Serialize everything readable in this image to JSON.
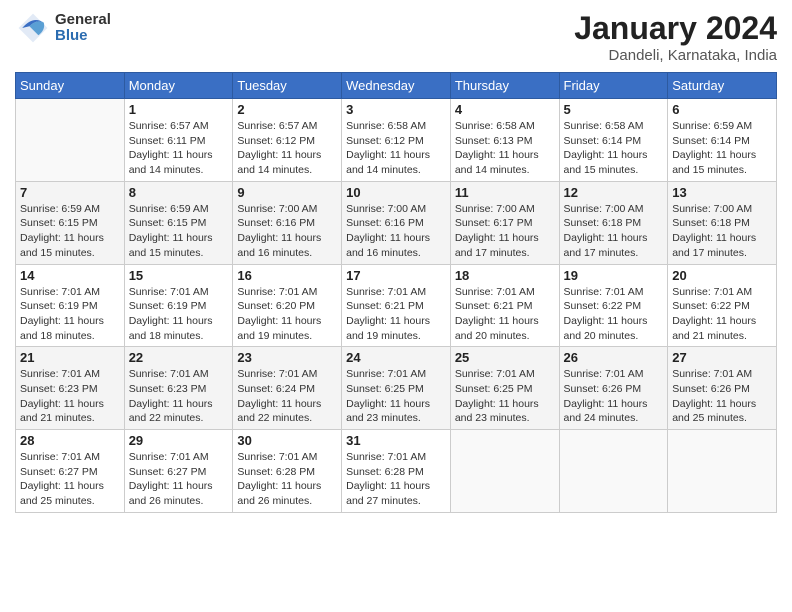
{
  "header": {
    "logo_general": "General",
    "logo_blue": "Blue",
    "title": "January 2024",
    "subtitle": "Dandeli, Karnataka, India"
  },
  "days_of_week": [
    "Sunday",
    "Monday",
    "Tuesday",
    "Wednesday",
    "Thursday",
    "Friday",
    "Saturday"
  ],
  "weeks": [
    [
      {
        "day": "",
        "empty": true
      },
      {
        "day": "1",
        "sunrise": "Sunrise: 6:57 AM",
        "sunset": "Sunset: 6:11 PM",
        "daylight": "Daylight: 11 hours and 14 minutes."
      },
      {
        "day": "2",
        "sunrise": "Sunrise: 6:57 AM",
        "sunset": "Sunset: 6:12 PM",
        "daylight": "Daylight: 11 hours and 14 minutes."
      },
      {
        "day": "3",
        "sunrise": "Sunrise: 6:58 AM",
        "sunset": "Sunset: 6:12 PM",
        "daylight": "Daylight: 11 hours and 14 minutes."
      },
      {
        "day": "4",
        "sunrise": "Sunrise: 6:58 AM",
        "sunset": "Sunset: 6:13 PM",
        "daylight": "Daylight: 11 hours and 14 minutes."
      },
      {
        "day": "5",
        "sunrise": "Sunrise: 6:58 AM",
        "sunset": "Sunset: 6:14 PM",
        "daylight": "Daylight: 11 hours and 15 minutes."
      },
      {
        "day": "6",
        "sunrise": "Sunrise: 6:59 AM",
        "sunset": "Sunset: 6:14 PM",
        "daylight": "Daylight: 11 hours and 15 minutes."
      }
    ],
    [
      {
        "day": "7",
        "sunrise": "Sunrise: 6:59 AM",
        "sunset": "Sunset: 6:15 PM",
        "daylight": "Daylight: 11 hours and 15 minutes."
      },
      {
        "day": "8",
        "sunrise": "Sunrise: 6:59 AM",
        "sunset": "Sunset: 6:15 PM",
        "daylight": "Daylight: 11 hours and 15 minutes."
      },
      {
        "day": "9",
        "sunrise": "Sunrise: 7:00 AM",
        "sunset": "Sunset: 6:16 PM",
        "daylight": "Daylight: 11 hours and 16 minutes."
      },
      {
        "day": "10",
        "sunrise": "Sunrise: 7:00 AM",
        "sunset": "Sunset: 6:16 PM",
        "daylight": "Daylight: 11 hours and 16 minutes."
      },
      {
        "day": "11",
        "sunrise": "Sunrise: 7:00 AM",
        "sunset": "Sunset: 6:17 PM",
        "daylight": "Daylight: 11 hours and 17 minutes."
      },
      {
        "day": "12",
        "sunrise": "Sunrise: 7:00 AM",
        "sunset": "Sunset: 6:18 PM",
        "daylight": "Daylight: 11 hours and 17 minutes."
      },
      {
        "day": "13",
        "sunrise": "Sunrise: 7:00 AM",
        "sunset": "Sunset: 6:18 PM",
        "daylight": "Daylight: 11 hours and 17 minutes."
      }
    ],
    [
      {
        "day": "14",
        "sunrise": "Sunrise: 7:01 AM",
        "sunset": "Sunset: 6:19 PM",
        "daylight": "Daylight: 11 hours and 18 minutes."
      },
      {
        "day": "15",
        "sunrise": "Sunrise: 7:01 AM",
        "sunset": "Sunset: 6:19 PM",
        "daylight": "Daylight: 11 hours and 18 minutes."
      },
      {
        "day": "16",
        "sunrise": "Sunrise: 7:01 AM",
        "sunset": "Sunset: 6:20 PM",
        "daylight": "Daylight: 11 hours and 19 minutes."
      },
      {
        "day": "17",
        "sunrise": "Sunrise: 7:01 AM",
        "sunset": "Sunset: 6:21 PM",
        "daylight": "Daylight: 11 hours and 19 minutes."
      },
      {
        "day": "18",
        "sunrise": "Sunrise: 7:01 AM",
        "sunset": "Sunset: 6:21 PM",
        "daylight": "Daylight: 11 hours and 20 minutes."
      },
      {
        "day": "19",
        "sunrise": "Sunrise: 7:01 AM",
        "sunset": "Sunset: 6:22 PM",
        "daylight": "Daylight: 11 hours and 20 minutes."
      },
      {
        "day": "20",
        "sunrise": "Sunrise: 7:01 AM",
        "sunset": "Sunset: 6:22 PM",
        "daylight": "Daylight: 11 hours and 21 minutes."
      }
    ],
    [
      {
        "day": "21",
        "sunrise": "Sunrise: 7:01 AM",
        "sunset": "Sunset: 6:23 PM",
        "daylight": "Daylight: 11 hours and 21 minutes."
      },
      {
        "day": "22",
        "sunrise": "Sunrise: 7:01 AM",
        "sunset": "Sunset: 6:23 PM",
        "daylight": "Daylight: 11 hours and 22 minutes."
      },
      {
        "day": "23",
        "sunrise": "Sunrise: 7:01 AM",
        "sunset": "Sunset: 6:24 PM",
        "daylight": "Daylight: 11 hours and 22 minutes."
      },
      {
        "day": "24",
        "sunrise": "Sunrise: 7:01 AM",
        "sunset": "Sunset: 6:25 PM",
        "daylight": "Daylight: 11 hours and 23 minutes."
      },
      {
        "day": "25",
        "sunrise": "Sunrise: 7:01 AM",
        "sunset": "Sunset: 6:25 PM",
        "daylight": "Daylight: 11 hours and 23 minutes."
      },
      {
        "day": "26",
        "sunrise": "Sunrise: 7:01 AM",
        "sunset": "Sunset: 6:26 PM",
        "daylight": "Daylight: 11 hours and 24 minutes."
      },
      {
        "day": "27",
        "sunrise": "Sunrise: 7:01 AM",
        "sunset": "Sunset: 6:26 PM",
        "daylight": "Daylight: 11 hours and 25 minutes."
      }
    ],
    [
      {
        "day": "28",
        "sunrise": "Sunrise: 7:01 AM",
        "sunset": "Sunset: 6:27 PM",
        "daylight": "Daylight: 11 hours and 25 minutes."
      },
      {
        "day": "29",
        "sunrise": "Sunrise: 7:01 AM",
        "sunset": "Sunset: 6:27 PM",
        "daylight": "Daylight: 11 hours and 26 minutes."
      },
      {
        "day": "30",
        "sunrise": "Sunrise: 7:01 AM",
        "sunset": "Sunset: 6:28 PM",
        "daylight": "Daylight: 11 hours and 26 minutes."
      },
      {
        "day": "31",
        "sunrise": "Sunrise: 7:01 AM",
        "sunset": "Sunset: 6:28 PM",
        "daylight": "Daylight: 11 hours and 27 minutes."
      },
      {
        "day": "",
        "empty": true
      },
      {
        "day": "",
        "empty": true
      },
      {
        "day": "",
        "empty": true
      }
    ]
  ]
}
